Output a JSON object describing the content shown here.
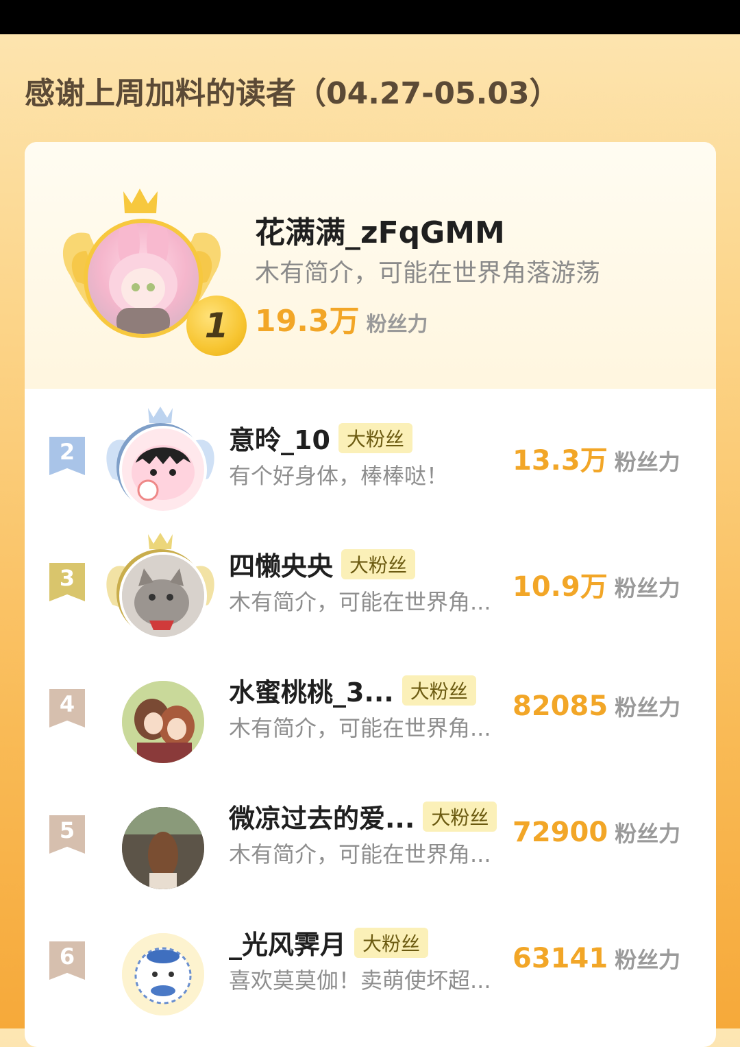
{
  "header": {
    "title": "感谢上周加料的读者（04.27-05.03）"
  },
  "colors": {
    "accent": "#f2a627",
    "gold": "#f7c83e",
    "silver": "#a9c4e8",
    "bronze": "#e3c86a",
    "badge_bg": "#fbf0b8"
  },
  "top": {
    "rank": "1",
    "name": "花满满_zFqGMM",
    "bio": "木有简介，可能在世界角落游荡",
    "fans_value": "19.3万",
    "fans_unit": "粉丝力"
  },
  "rows": [
    {
      "rank": "2",
      "name": "意昤_10",
      "badge": "大粉丝",
      "bio": "有个好身体，棒棒哒！",
      "fans_value": "13.3万",
      "fans_unit": "粉丝力"
    },
    {
      "rank": "3",
      "name": "四懒央央",
      "badge": "大粉丝",
      "bio": "木有简介，可能在世界角...",
      "fans_value": "10.9万",
      "fans_unit": "粉丝力"
    },
    {
      "rank": "4",
      "name": "水蜜桃桃_3...",
      "badge": "大粉丝",
      "bio": "木有简介，可能在世界角...",
      "fans_value": "82085",
      "fans_unit": "粉丝力"
    },
    {
      "rank": "5",
      "name": "微凉过去的爱...",
      "badge": "大粉丝",
      "bio": "木有简介，可能在世界角...",
      "fans_value": "72900",
      "fans_unit": "粉丝力"
    },
    {
      "rank": "6",
      "name": "_光风霁月",
      "badge": "大粉丝",
      "bio": "喜欢莫莫伽！卖萌使坏超...",
      "fans_value": "63141",
      "fans_unit": "粉丝力"
    }
  ]
}
